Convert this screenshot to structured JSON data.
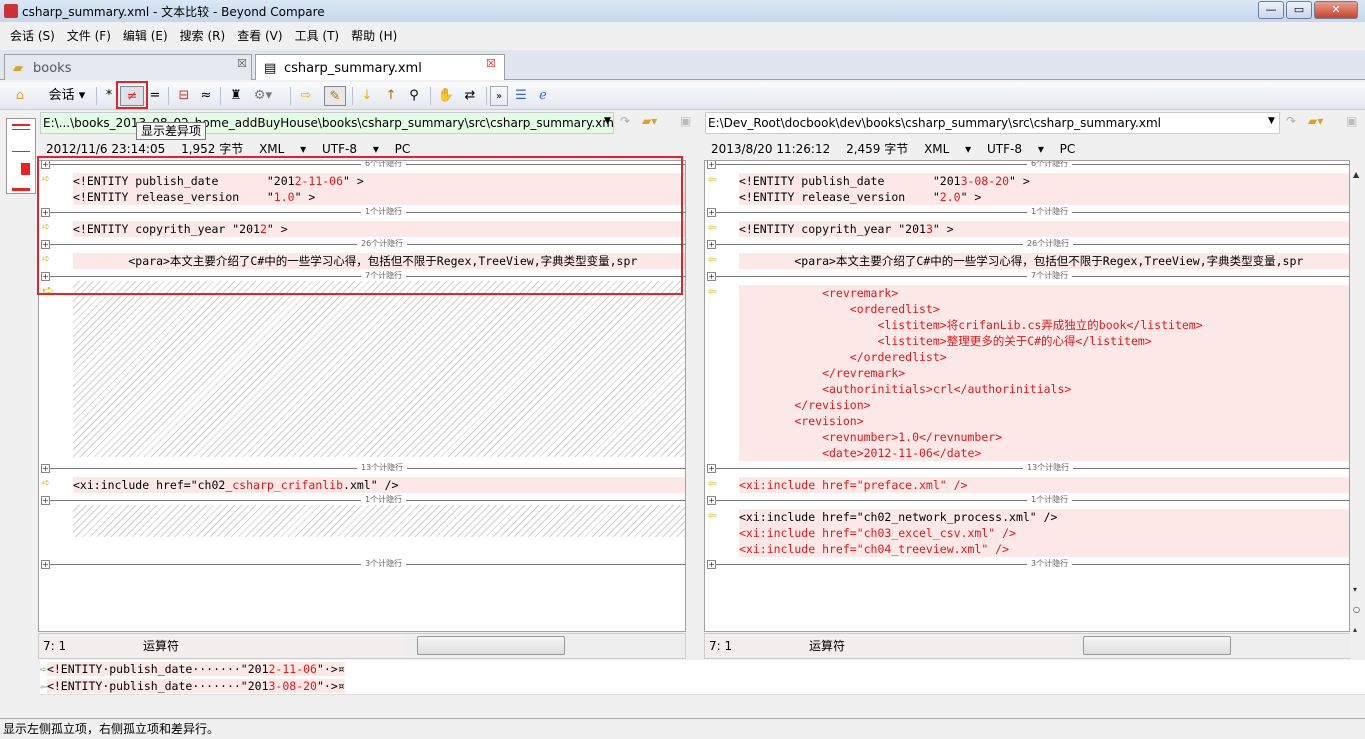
{
  "window": {
    "title": "csharp_summary.xml - 文本比较 - Beyond Compare"
  },
  "menu": [
    "会话 (S)",
    "文件 (F)",
    "编辑 (E)",
    "搜索 (R)",
    "查看 (V)",
    "工具 (T)",
    "帮助 (H)"
  ],
  "tabs": [
    {
      "label": "books"
    },
    {
      "label": "csharp_summary.xml"
    }
  ],
  "toolbar": {
    "session_label": "会话",
    "tooltip": "显示差异项",
    "all_label": "*",
    "diff_label": "≠",
    "same_label": "=",
    "minor_label": "≈"
  },
  "left": {
    "path": "E:\\...\\books_2013_08_02_home_addBuyHouse\\books\\csharp_summary\\src\\csharp_summary.xml",
    "date": "2012/11/6 23:14:05",
    "size": "1,952 字节",
    "format": "XML",
    "encoding": "UTF-8",
    "lineend": "PC",
    "position": "7: 1",
    "context": "运算符"
  },
  "right": {
    "path": "E:\\Dev_Root\\docbook\\dev\\books\\csharp_summary\\src\\csharp_summary.xml",
    "date": "2013/8/20 11:26:12",
    "size": "2,459 字节",
    "format": "XML",
    "encoding": "UTF-8",
    "lineend": "PC",
    "position": "7: 1",
    "context": "运算符"
  },
  "separators": [
    "6个计隐行",
    "1个计隐行",
    "26个计隐行",
    "7个计隐行",
    "13个计隐行",
    "1个计隐行",
    "3个计隐行"
  ],
  "left_lines": [
    {
      "y": 0,
      "arrow": true,
      "segs": [
        [
          "<!ENTITY publish_date       \"201",
          0
        ],
        [
          "2-11-06",
          1
        ],
        [
          "\" >",
          0
        ]
      ]
    },
    {
      "y": 1,
      "segs": [
        [
          "<!ENTITY release_version    \"",
          0
        ],
        [
          "1.0",
          1
        ],
        [
          "\" >",
          0
        ]
      ]
    },
    {
      "y": 3,
      "arrow": true,
      "segs": [
        [
          "<!ENTITY copyrith_year \"201",
          0
        ],
        [
          "2",
          1
        ],
        [
          "\" >",
          0
        ]
      ]
    },
    {
      "y": 5,
      "arrow": true,
      "segs": [
        [
          "        <para>本文主要介绍了C#中的一些学习心得，包括但不限于Regex,TreeView,字典类型变量,spr",
          0
        ]
      ]
    },
    {
      "y": 19,
      "arrow": true,
      "segs": [
        [
          "<xi:include href=\"ch02_",
          0
        ],
        [
          "csharp_crifanlib",
          1
        ],
        [
          ".xml\" />",
          0
        ]
      ]
    }
  ],
  "right_lines": [
    {
      "y": 0,
      "arrow": true,
      "segs": [
        [
          "<!ENTITY publish_date       \"201",
          0
        ],
        [
          "3-08-20",
          1
        ],
        [
          "\" >",
          0
        ]
      ]
    },
    {
      "y": 1,
      "segs": [
        [
          "<!ENTITY release_version    \"",
          0
        ],
        [
          "2.0",
          1
        ],
        [
          "\" >",
          0
        ]
      ]
    },
    {
      "y": 3,
      "arrow": true,
      "segs": [
        [
          "<!ENTITY copyrith_year \"201",
          0
        ],
        [
          "3",
          1
        ],
        [
          "\" >",
          0
        ]
      ]
    },
    {
      "y": 5,
      "arrow": true,
      "segs": [
        [
          "        <para>本文主要介绍了C#中的一些学习心得，包括但不限于Regex,TreeView,字典类型变量,spr",
          0
        ]
      ]
    },
    {
      "y": 7,
      "arrow": true,
      "segs": [
        [
          "            <revremark>",
          1
        ]
      ]
    },
    {
      "y": 8,
      "segs": [
        [
          "                <orderedlist>",
          1
        ]
      ]
    },
    {
      "y": 9,
      "segs": [
        [
          "                    <listitem>将crifanLib.cs弄成独立的book</listitem>",
          1
        ]
      ]
    },
    {
      "y": 10,
      "segs": [
        [
          "                    <listitem>整理更多的关于C#的心得</listitem>",
          1
        ]
      ]
    },
    {
      "y": 11,
      "segs": [
        [
          "                </orderedlist>",
          1
        ]
      ]
    },
    {
      "y": 12,
      "segs": [
        [
          "            </revremark>",
          1
        ]
      ]
    },
    {
      "y": 13,
      "segs": [
        [
          "            <authorinitials>crl</authorinitials>",
          1
        ]
      ]
    },
    {
      "y": 14,
      "segs": [
        [
          "        </revision>",
          1
        ]
      ]
    },
    {
      "y": 15,
      "segs": [
        [
          "        <revision>",
          1
        ]
      ]
    },
    {
      "y": 16,
      "segs": [
        [
          "            <revnumber>1.0</revnumber>",
          1
        ]
      ]
    },
    {
      "y": 17,
      "segs": [
        [
          "            <date>2012-11-06</date>",
          1
        ]
      ]
    },
    {
      "y": 19,
      "arrow": true,
      "segs": [
        [
          "<xi:include href=\"preface.xml\" />",
          1
        ]
      ]
    },
    {
      "y": 21,
      "arrow": true,
      "segs": [
        [
          "<xi:include href=\"ch02_network_process.xml\" />",
          0
        ]
      ]
    },
    {
      "y": 22,
      "segs": [
        [
          "<xi:include href=\"ch03_excel_csv.xml\" />",
          1
        ]
      ]
    },
    {
      "y": 23,
      "segs": [
        [
          "<xi:include href=\"ch04_treeview.xml\" />",
          1
        ]
      ]
    }
  ],
  "detail": {
    "left": [
      [
        "<!ENTITY·publish_date·······\"201",
        0
      ],
      [
        "2-11-06",
        1
      ],
      [
        "\"·>¤",
        0
      ]
    ],
    "right": [
      [
        "<!ENTITY·publish_date·······\"201",
        0
      ],
      [
        "3-08-20",
        1
      ],
      [
        "\"·>¤",
        0
      ]
    ]
  },
  "statusbar": "显示左侧孤立项，右侧孤立项和差异行。"
}
